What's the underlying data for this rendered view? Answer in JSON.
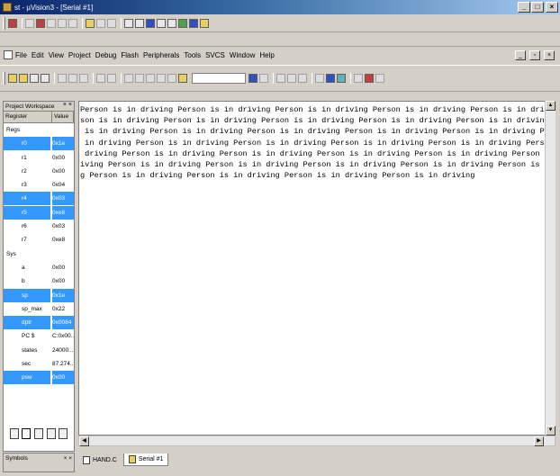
{
  "window": {
    "title": "st - µVision3 - [Serial #1]"
  },
  "menu": [
    "File",
    "Edit",
    "View",
    "Project",
    "Debug",
    "Flash",
    "Peripherals",
    "Tools",
    "SVCS",
    "Window",
    "Help"
  ],
  "workspace": {
    "title": "Project Workspace",
    "col_register": "Register",
    "col_value": "Value",
    "rows": [
      {
        "name": "Regs",
        "value": "",
        "sel": false,
        "top": true
      },
      {
        "name": "r0",
        "value": "0x1e",
        "sel": true
      },
      {
        "name": "r1",
        "value": "0x00",
        "sel": false
      },
      {
        "name": "r2",
        "value": "0x00",
        "sel": false
      },
      {
        "name": "r3",
        "value": "0x04",
        "sel": false
      },
      {
        "name": "r4",
        "value": "0x03",
        "sel": true
      },
      {
        "name": "r5",
        "value": "0xe8",
        "sel": true
      },
      {
        "name": "r6",
        "value": "0x03",
        "sel": false
      },
      {
        "name": "r7",
        "value": "0xe8",
        "sel": false
      },
      {
        "name": "Sys",
        "value": "",
        "sel": false,
        "top": true
      },
      {
        "name": "a",
        "value": "0x00",
        "sel": false
      },
      {
        "name": "b",
        "value": "0x00",
        "sel": false
      },
      {
        "name": "sp",
        "value": "0x1e",
        "sel": true
      },
      {
        "name": "sp_max",
        "value": "0x22",
        "sel": false
      },
      {
        "name": "dptr",
        "value": "0x0084",
        "sel": true
      },
      {
        "name": "PC $",
        "value": "C:0x00...",
        "sel": false
      },
      {
        "name": "states",
        "value": "24000...",
        "sel": false
      },
      {
        "name": "sec",
        "value": "87.274...",
        "sel": false
      },
      {
        "name": "psw",
        "value": "0x00",
        "sel": true
      }
    ]
  },
  "symbols_label": "Symbols",
  "serial_lines": [
    "Person is in driving Person is in driving Person is in driving Person is in driving Person is in driving Pe",
    "son is in driving Person is in driving Person is in driving Person is in driving Person is in driving Perso",
    " is in driving Person is in driving Person is in driving Person is in driving Person is in driving Person i",
    " in driving Person is in driving Person is in driving Person is in driving Person is in driving Person is i",
    " driving Person is in driving Person is in driving Person is in driving Person is in driving Person is in d",
    "iving Person is in driving Person is in driving Person is in driving Person is in driving Person is in driv",
    "g Person is in driving Person is in driving Person is in driving Person is in driving"
  ],
  "doc_tabs": [
    "HAND.C",
    "Serial #1"
  ]
}
